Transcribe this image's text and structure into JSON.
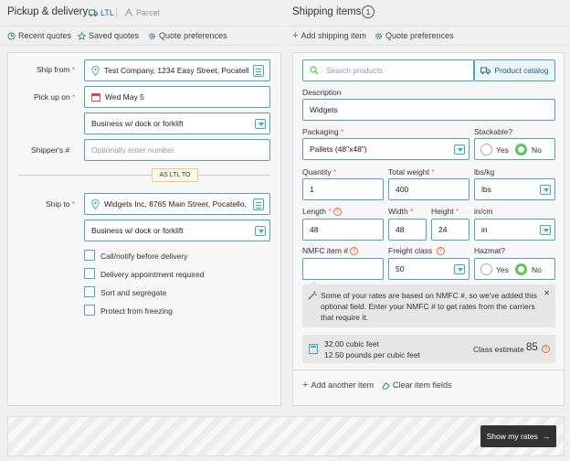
{
  "left": {
    "title": "Pickup & delivery",
    "tabs": [
      {
        "label": "LTL",
        "icon": "truck-icon"
      },
      {
        "label": "Parcel",
        "icon": "parcel-icon"
      }
    ],
    "links": [
      {
        "label": "Recent quotes",
        "icon": "history-icon"
      },
      {
        "label": "Saved quotes",
        "icon": "star-icon"
      },
      {
        "label": "Quote preferences",
        "icon": "gear-icon"
      }
    ],
    "ship_from_label": "Ship from",
    "ship_from_value": "Test Company, 1234 Easy Street, Pocatell",
    "pickup_label": "Pick up on",
    "pickup_value": "Wed May 5",
    "pickup_loc_type": "Business w/ dock or forklift",
    "shippers_label": "Shipper's #",
    "shippers_placeholder": "Optionally enter number",
    "as_ltl_to": "AS LTL TO",
    "ship_to_label": "Ship to",
    "ship_to_value": "Widgets Inc, 8765 Main Street, Pocatello,",
    "delivery_loc_type": "Business w/ dock or forklift",
    "options": [
      "Call/notify before delivery",
      "Delivery appointment required",
      "Sort and segregate",
      "Protect from freezing"
    ]
  },
  "right": {
    "title": "Shipping items",
    "count": "1",
    "links": [
      {
        "label": "Add shipping item",
        "icon": "plus-icon"
      },
      {
        "label": "Quote preferences",
        "icon": "gear-icon"
      }
    ],
    "search_placeholder": "Search products",
    "catalog_label": "Product catalog",
    "description_label": "Description",
    "description_value": "Widgets",
    "packaging_label": "Packaging",
    "packaging_value": "Pallets (48\"x48\")",
    "stackable_label": "Stackable?",
    "yes": "Yes",
    "no": "No",
    "quantity_label": "Quantity",
    "quantity_value": "1",
    "weight_label": "Total weight",
    "weight_value": "400",
    "lbskg_label": "lbs/kg",
    "lbskg_value": "lbs",
    "length_label": "Length",
    "length_value": "48",
    "width_label": "Width",
    "width_value": "48",
    "height_label": "Height",
    "height_value": "24",
    "incm_label": "in/cm",
    "incm_value": "in",
    "nmfc_label": "NMFC item #",
    "freight_label": "Freight class",
    "freight_value": "50",
    "hazmat_label": "Hazmat?",
    "notice": "Some of your rates are based on NMFC #, so we've added this optional field. Enter your NMFC # to get rates from the carriers that require it.",
    "cubic_feet": "32.00 cubic feet",
    "pcf": "12.50 pounds per cubic feet",
    "class_estimate_label": "Class estimate",
    "class_estimate_value": "85",
    "add_another": "Add another item",
    "clear_fields": "Clear item fields"
  },
  "footer": {
    "show_rates": "Show my rates"
  },
  "colors": {
    "accent": "#4fa6b3",
    "required": "#e8703a",
    "radio_on": "#5bc45c",
    "button": "#333333"
  }
}
